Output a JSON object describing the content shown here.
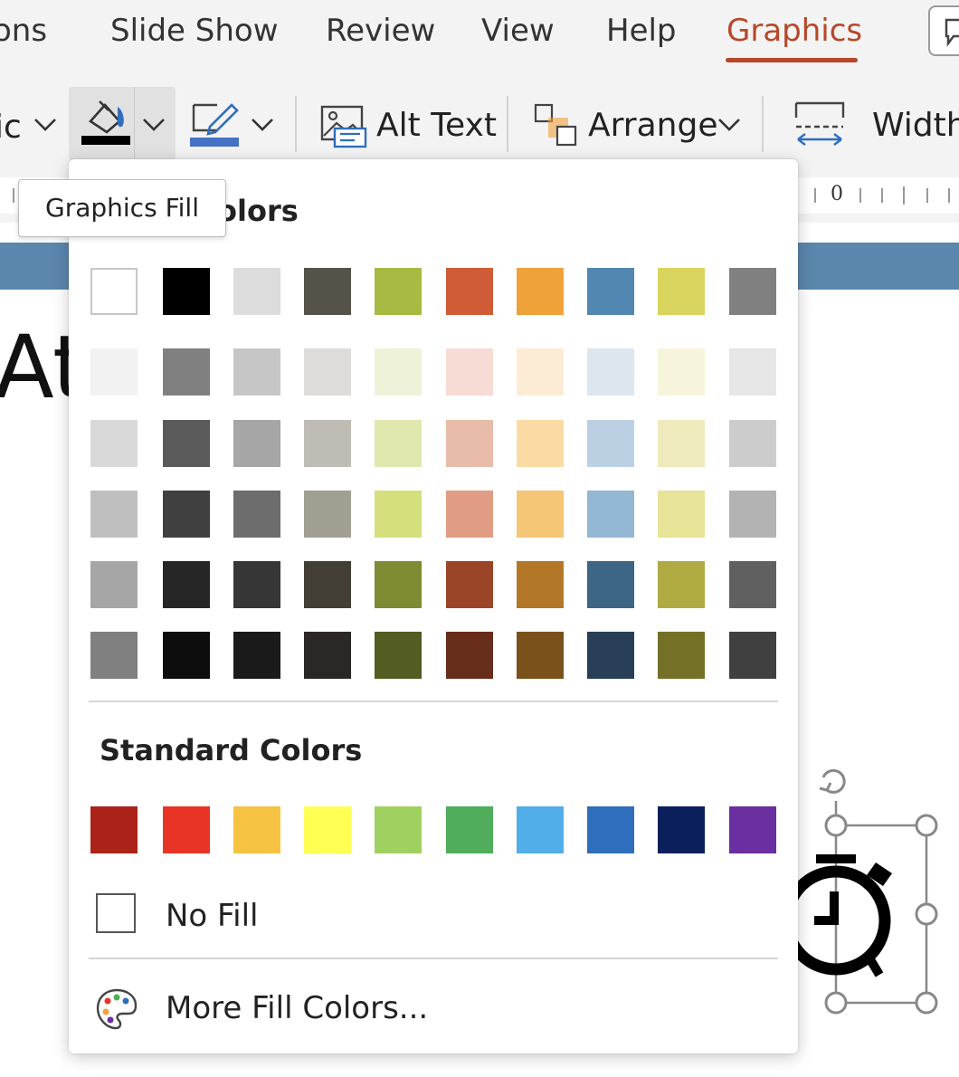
{
  "tabs": [
    {
      "label": "ons",
      "active": false
    },
    {
      "label": "Slide Show",
      "active": false
    },
    {
      "label": "Review",
      "active": false
    },
    {
      "label": "View",
      "active": false
    },
    {
      "label": "Help",
      "active": false
    },
    {
      "label": "Graphics",
      "active": true
    }
  ],
  "ribbon": {
    "graphic_style_partial": "ic",
    "fill_color": "#000000",
    "outline_color": "#4472c4",
    "alt_text_label": "Alt Text",
    "arrange_label": "Arrange",
    "width_label": "Width"
  },
  "ruler": {
    "zero_label": "0"
  },
  "tooltip": {
    "text": "Graphics Fill"
  },
  "dropdown": {
    "theme_colors_title": "Theme Colors",
    "theme_colors_title_visible": "olors",
    "theme_colors": [
      [
        "#ffffff",
        "#000000",
        "#dcdcdc",
        "#55524a",
        "#a9ba42",
        "#cf5c36",
        "#f0a23a",
        "#5287b1",
        "#d9d45d",
        "#808080"
      ],
      [
        "#f2f2f2",
        "#808080",
        "#c6c6c6",
        "#dddcda",
        "#eef2d9",
        "#f6dcd4",
        "#fcecd6",
        "#dbe6ef",
        "#f6f5db",
        "#e6e6e6"
      ],
      [
        "#d9d9d9",
        "#5a5a5a",
        "#a6a6a6",
        "#bfbcb5",
        "#e1e8ae",
        "#e9bcaa",
        "#f9dba3",
        "#bbd0e3",
        "#eeeabc",
        "#cccccc"
      ],
      [
        "#bfbfbf",
        "#404040",
        "#6d6d6d",
        "#a19e92",
        "#d5e07d",
        "#e19d83",
        "#f4c675",
        "#94b7d3",
        "#e7e397",
        "#b3b3b3"
      ],
      [
        "#a6a6a6",
        "#262626",
        "#363636",
        "#433f36",
        "#7f8a32",
        "#9b4428",
        "#b27827",
        "#3d6586",
        "#afab42",
        "#606060"
      ],
      [
        "#808080",
        "#0d0d0d",
        "#1a1a1a",
        "#2a2824",
        "#535c21",
        "#672d1b",
        "#7a511b",
        "#283f57",
        "#747127",
        "#404040"
      ]
    ],
    "standard_colors_title": "Standard Colors",
    "standard_colors": [
      "#ab2219",
      "#e83426",
      "#f5c242",
      "#ffff54",
      "#a0d060",
      "#4fad5b",
      "#51aee8",
      "#2f6ebc",
      "#0b1f5c",
      "#6a2fa0"
    ],
    "no_fill_label": "No Fill",
    "more_colors_label": "More Fill Colors..."
  },
  "slide": {
    "title_fragment": "Att",
    "band_color": "#5b87ad"
  }
}
